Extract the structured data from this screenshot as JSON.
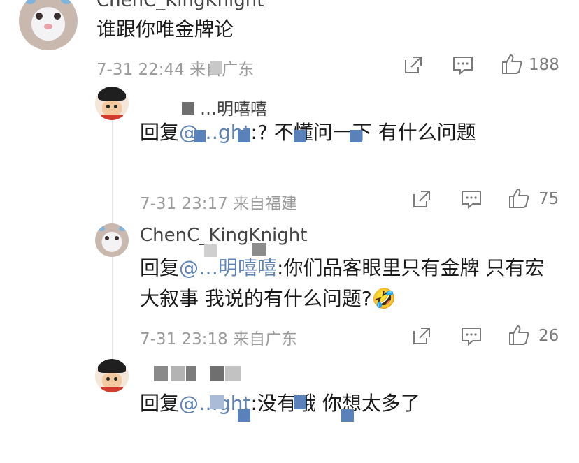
{
  "comments": [
    {
      "username": "ChenC_KingKnight",
      "text": "谁跟你唯金牌论",
      "time": "7-31 22:44",
      "source": "来自广东",
      "likes": "188"
    },
    {
      "username": "…明嘻嘻",
      "reply_prefix": "回复",
      "mention": "@…ght",
      "text": ":? 不懂问一下 有什么问题",
      "time": "7-31 23:17",
      "source": "来自福建",
      "likes": "75"
    },
    {
      "username": "ChenC_KingKnight",
      "reply_prefix": "回复",
      "mention": "@…明嘻嘻",
      "text": ":你们品客眼里只有金牌 只有宏大叙事 我说的有什么问题?",
      "emoji": "🤣",
      "time": "7-31 23:18",
      "source": "来自广东",
      "likes": "26"
    },
    {
      "reply_prefix": "回复",
      "mention": "@…ght",
      "text": ":没有哦 你想太多了"
    }
  ],
  "icons": {
    "share": "share-icon",
    "comment": "comment-icon",
    "like": "thumbs-up-icon"
  }
}
